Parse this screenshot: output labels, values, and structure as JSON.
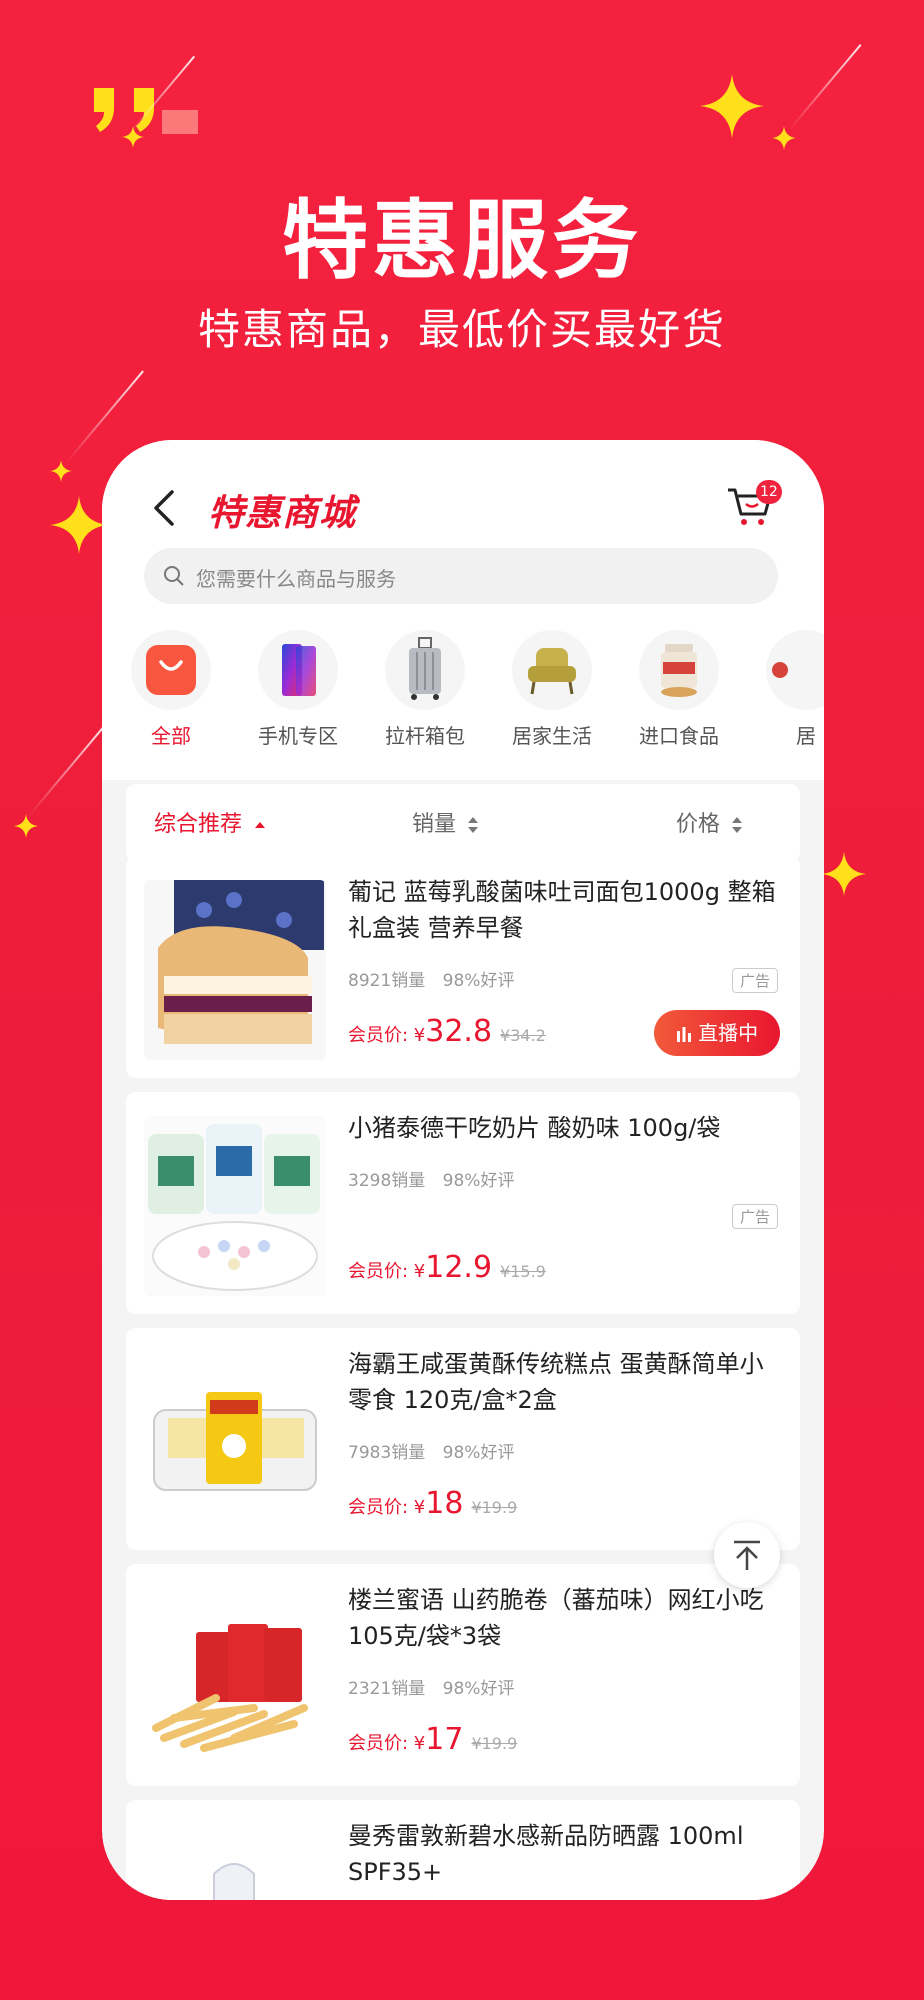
{
  "promo": {
    "title": "特惠服务",
    "subtitle": "特惠商品，最低价买最好货"
  },
  "header": {
    "title": "特惠商城",
    "cart_count": "12"
  },
  "search": {
    "placeholder": "您需要什么商品与服务"
  },
  "categories": [
    {
      "label": "全部",
      "icon": "shopping-bag-icon",
      "active": true
    },
    {
      "label": "手机专区",
      "icon": "phone-icon"
    },
    {
      "label": "拉杆箱包",
      "icon": "suitcase-icon"
    },
    {
      "label": "居家生活",
      "icon": "sofa-icon"
    },
    {
      "label": "进口食品",
      "icon": "food-jar-icon"
    },
    {
      "label": "居",
      "icon": "more-category-icon"
    }
  ],
  "sort": {
    "comprehensive": "综合推荐",
    "sales": "销量",
    "price": "价格"
  },
  "products": [
    {
      "title": "葡记 蓝莓乳酸菌味吐司面包1000g 整箱礼盒装 营养早餐",
      "sales": "8921销量",
      "rating": "98%好评",
      "ad": "广告",
      "price_label": "会员价: ",
      "currency": "¥",
      "price": "32.8",
      "old_price": "¥34.2",
      "live": "直播中"
    },
    {
      "title": "小猪泰德干吃奶片 酸奶味 100g/袋",
      "sales": "3298销量",
      "rating": "98%好评",
      "ad": "广告",
      "price_label": "会员价: ",
      "currency": "¥",
      "price": "12.9",
      "old_price": "¥15.9"
    },
    {
      "title": "海霸王咸蛋黄酥传统糕点 蛋黄酥简单小零食 120克/盒*2盒",
      "sales": "7983销量",
      "rating": "98%好评",
      "price_label": "会员价: ",
      "currency": "¥",
      "price": "18",
      "old_price": "¥19.9"
    },
    {
      "title": "楼兰蜜语 山药脆卷（蕃茄味）网红小吃 105克/袋*3袋",
      "sales": "2321销量",
      "rating": "98%好评",
      "price_label": "会员价: ",
      "currency": "¥",
      "price": "17",
      "old_price": "¥19.9"
    },
    {
      "title": "曼秀雷敦新碧水感新品防晒露 100ml SPF35+"
    }
  ],
  "colors": {
    "brand_red": "#e8162f",
    "background_red": "#f0203d",
    "sparkle_yellow": "#ffe01a"
  }
}
